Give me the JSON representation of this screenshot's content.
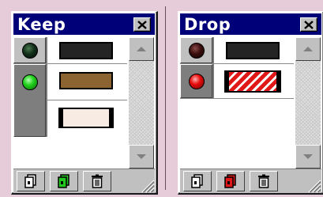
{
  "palettes": [
    {
      "title": "Keep",
      "rows": [
        {
          "lamp_color": "#0f2b12",
          "swatch_color": "#242424",
          "swatch_pattern": "solid",
          "selected": false
        },
        {
          "lamp_color": "#22d21e",
          "swatch_color": "#8c6432",
          "swatch_pattern": "solid",
          "selected": true
        },
        {
          "lamp_color": "",
          "swatch_color": "#f8ebe3",
          "swatch_pattern": "solid",
          "selected": true
        }
      ],
      "toolbar": {
        "buttons": [
          "new-layer-icon",
          "new-keep-layer-icon",
          "trash-icon"
        ],
        "accent": "#22c81e"
      }
    },
    {
      "title": "Drop",
      "rows": [
        {
          "lamp_color": "#3a0c0c",
          "swatch_color": "#242424",
          "swatch_pattern": "solid",
          "selected": false
        },
        {
          "lamp_color": "#e80c0c",
          "swatch_color": "#e01818",
          "swatch_pattern": "stripes",
          "selected": true
        }
      ],
      "toolbar": {
        "buttons": [
          "new-layer-icon",
          "new-drop-layer-icon",
          "trash-icon"
        ],
        "accent": "#e01818"
      }
    }
  ]
}
